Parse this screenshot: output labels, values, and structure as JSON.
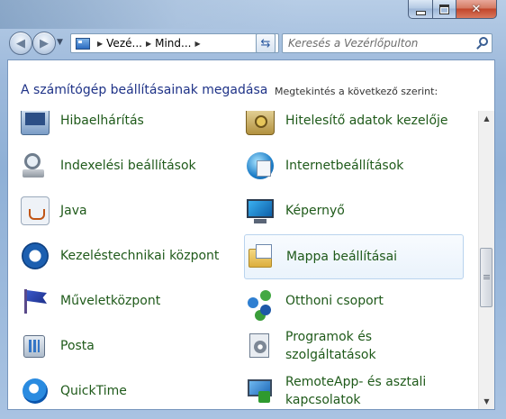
{
  "window": {
    "minimize_symbol": "",
    "close_symbol": "✕"
  },
  "nav": {
    "breadcrumb": [
      "Vezé...",
      "Mind..."
    ],
    "search_placeholder": "Keresés a Vezérlőpulton"
  },
  "header": {
    "title": "A számítógép beállításainak megadása",
    "view_by_label": "Megtekintés a következő szerint:"
  },
  "items": {
    "hibaelharitas": "Hibaelhárítás",
    "hitelesito": "Hitelesítő adatok kezelője",
    "indexeles": "Indexelési beállítások",
    "internet": "Internetbeállítások",
    "java": "Java",
    "kepernyo": "Képernyő",
    "kezelestechnikai": "Kezeléstechnikai központ",
    "mappa": "Mappa beállításai",
    "muveletkozpont": "Műveletközpont",
    "otthoni": "Otthoni csoport",
    "posta": "Posta",
    "programok_line1": "Programok és",
    "programok_line2": "szolgáltatások",
    "quicktime": "QuickTime",
    "remoteapp_line1": "RemoteApp- és asztali",
    "remoteapp_line2": "kapcsolatok"
  },
  "colors": {
    "title_blue": "#1e3287",
    "link_green": "#1f5a1a"
  },
  "icons": {
    "hibaelharitas": "troubleshooting-icon",
    "hitelesito": "credential-manager-icon",
    "indexeles": "indexing-options-icon",
    "internet": "internet-options-icon",
    "java": "java-icon",
    "kepernyo": "display-icon",
    "kezelestechnikai": "ease-of-access-icon",
    "mappa": "folder-options-icon",
    "muveletkozpont": "action-center-flag-icon",
    "otthoni": "homegroup-icon",
    "posta": "mail-icon",
    "programok": "programs-features-icon",
    "quicktime": "quicktime-icon",
    "remoteapp": "remoteapp-icon"
  }
}
